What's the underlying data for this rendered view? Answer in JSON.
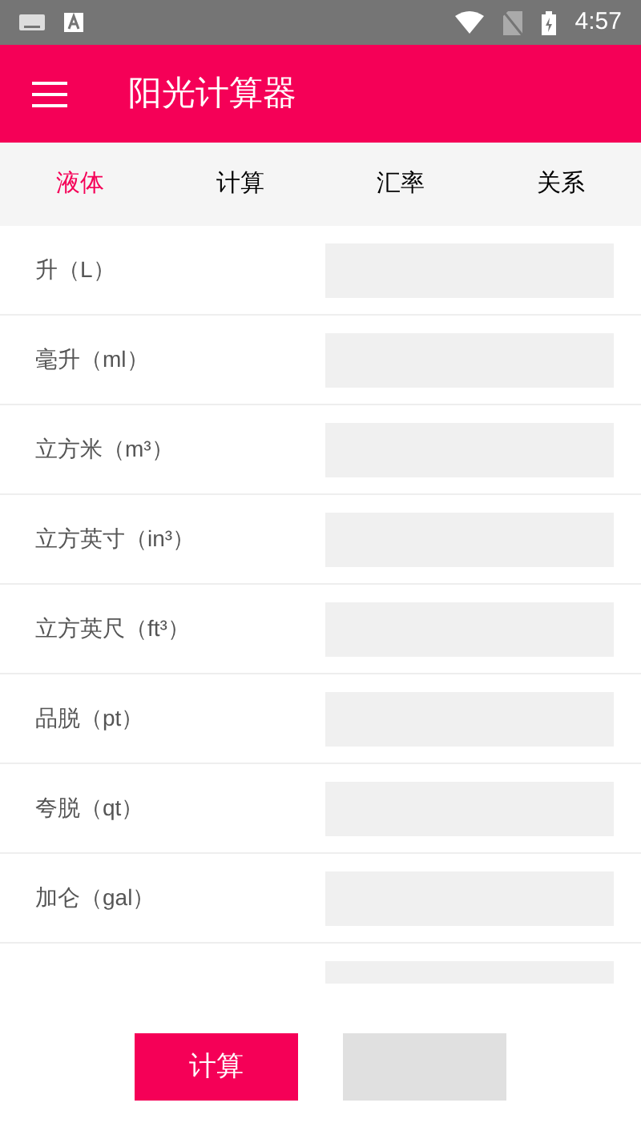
{
  "status_bar": {
    "time": "4:57"
  },
  "app_bar": {
    "title": "阳光计算器"
  },
  "tabs": [
    {
      "label": "液体",
      "selected": true
    },
    {
      "label": "计算",
      "selected": false
    },
    {
      "label": "汇率",
      "selected": false
    },
    {
      "label": "关系",
      "selected": false
    }
  ],
  "rows": [
    {
      "label": "升（L）"
    },
    {
      "label": "毫升（ml）"
    },
    {
      "label": "立方米（m³）"
    },
    {
      "label": "立方英寸（in³）"
    },
    {
      "label": "立方英尺（ft³）"
    },
    {
      "label": "品脱（pt）"
    },
    {
      "label": "夸脱（qt）"
    },
    {
      "label": "加仑（gal）"
    },
    {}
  ],
  "buttons": [
    {
      "label": "计算",
      "kind": "primary"
    },
    {
      "kind": "secondary"
    }
  ]
}
